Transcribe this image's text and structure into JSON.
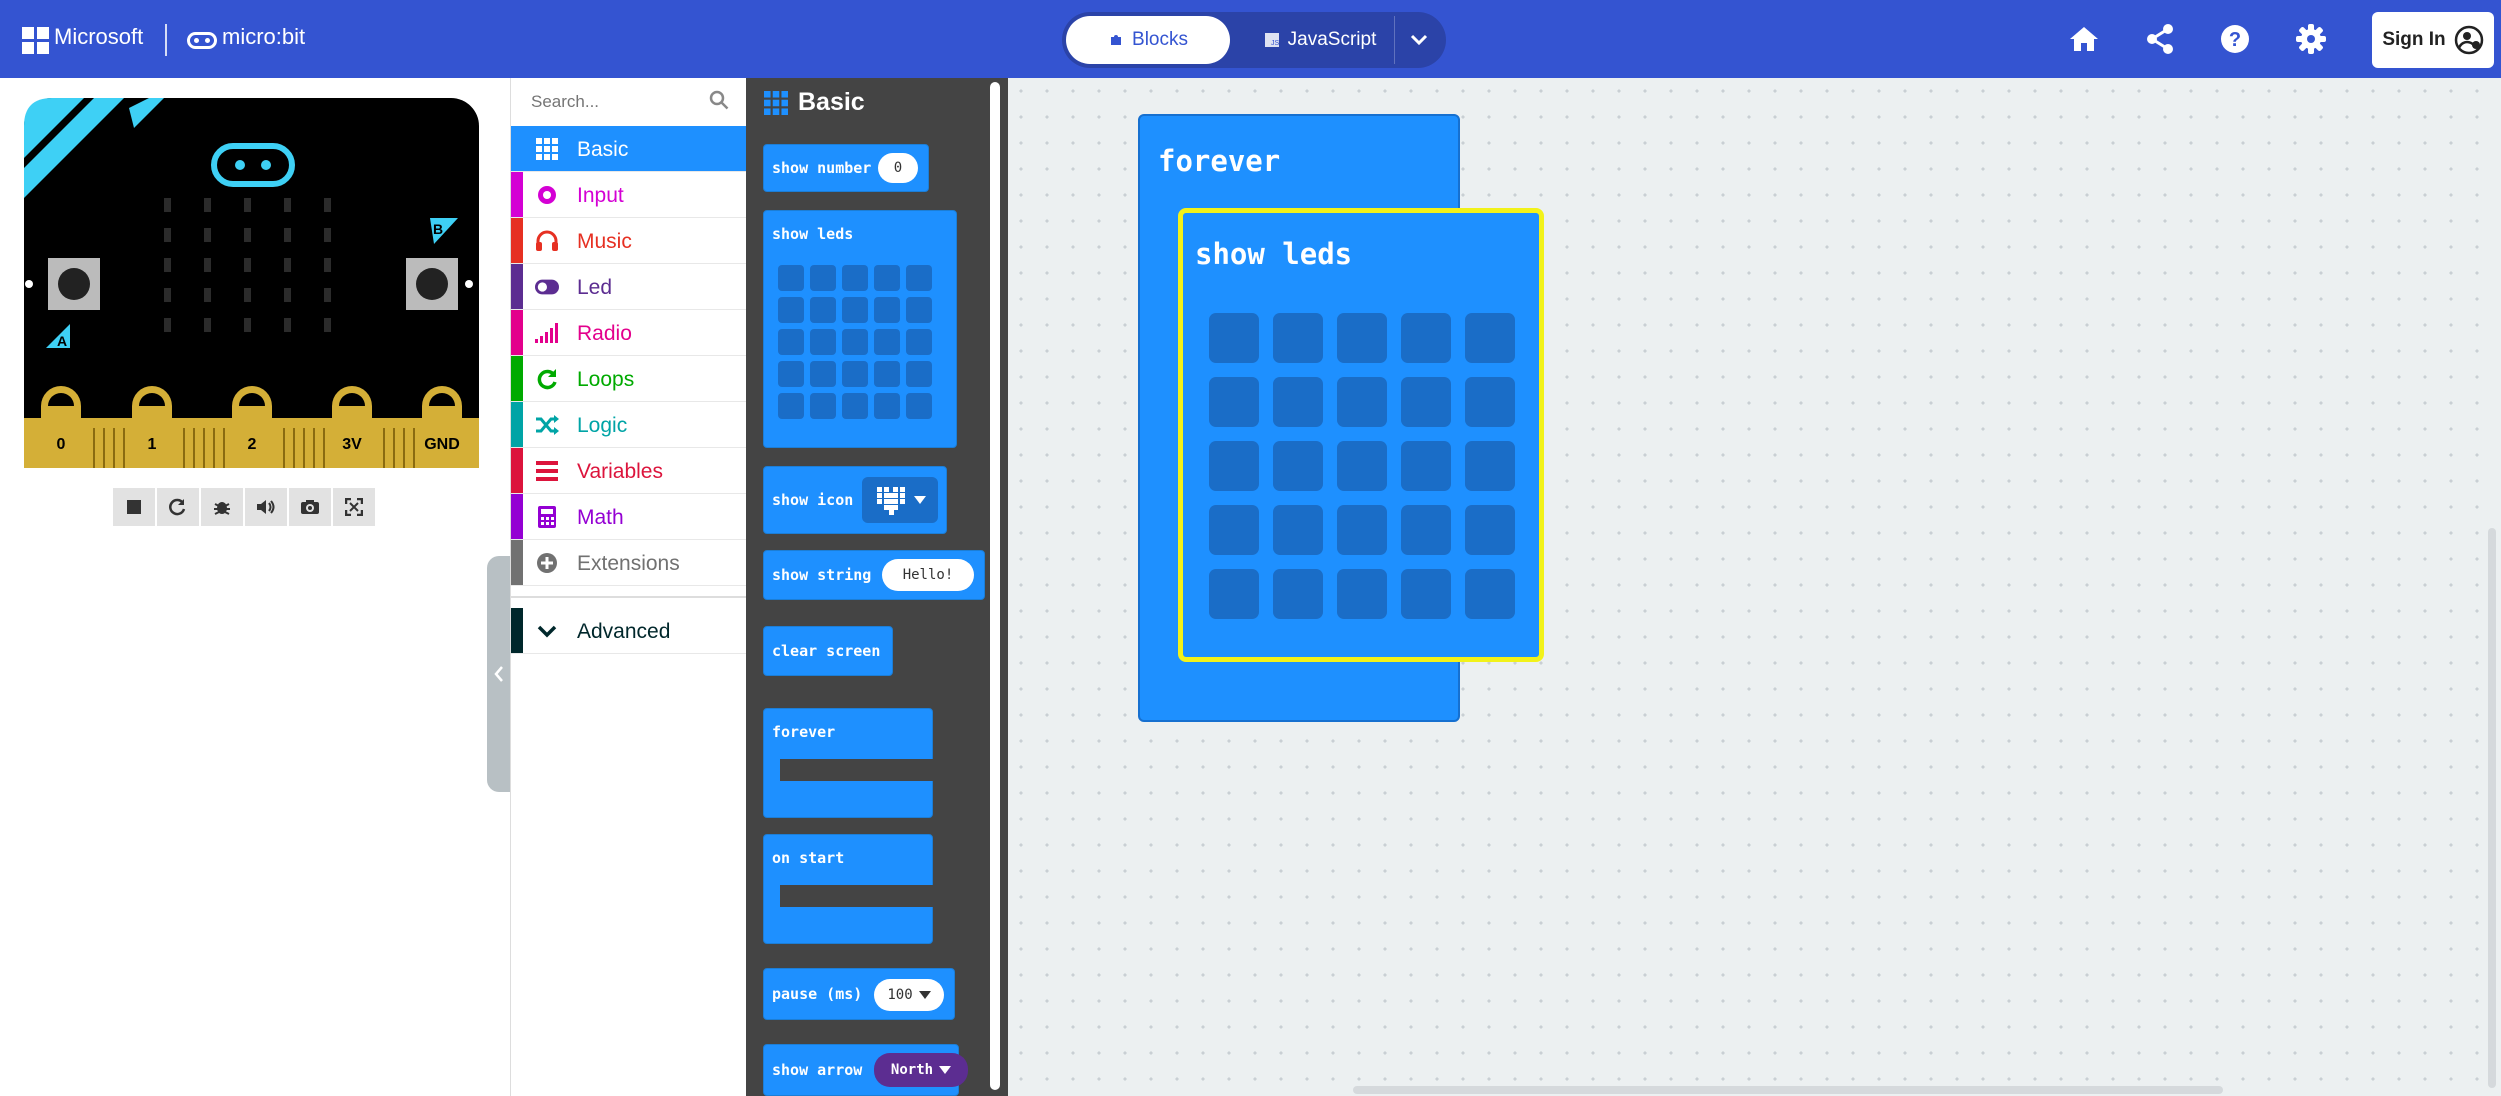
{
  "header": {
    "microsoft_label": "Microsoft",
    "microbit_label": "micro:bit",
    "tabs": [
      {
        "label": "Blocks",
        "active": true,
        "icon": "puzzle-icon"
      },
      {
        "label": "JavaScript",
        "active": false,
        "icon": "js-icon"
      }
    ],
    "icons": [
      "home-icon",
      "share-icon",
      "help-icon",
      "gear-icon"
    ],
    "signin_label": "Sign In"
  },
  "simulator": {
    "pin_labels": [
      "0",
      "1",
      "2",
      "3V",
      "GND"
    ],
    "button_labels": [
      "A",
      "B"
    ],
    "toolbar_icons": [
      "stop-icon",
      "restart-icon",
      "debug-icon",
      "sound-icon",
      "screenshot-icon",
      "fullscreen-icon"
    ]
  },
  "toolbox": {
    "search_placeholder": "Search...",
    "categories": [
      {
        "label": "Basic",
        "color": "#1e90ff",
        "selected": true,
        "icon": "grid-icon"
      },
      {
        "label": "Input",
        "color": "#d400d4",
        "icon": "circle-icon"
      },
      {
        "label": "Music",
        "color": "#e63022",
        "icon": "headphones-icon"
      },
      {
        "label": "Led",
        "color": "#5c2d91",
        "icon": "toggle-icon"
      },
      {
        "label": "Radio",
        "color": "#e3008c",
        "icon": "signal-icon"
      },
      {
        "label": "Loops",
        "color": "#00aa00",
        "icon": "refresh-icon"
      },
      {
        "label": "Logic",
        "color": "#00a4a6",
        "icon": "shuffle-icon"
      },
      {
        "label": "Variables",
        "color": "#dc143c",
        "icon": "list-icon"
      },
      {
        "label": "Math",
        "color": "#9400d3",
        "icon": "calculator-icon"
      },
      {
        "label": "Extensions",
        "color": "#717171",
        "icon": "plus-icon"
      },
      {
        "label": "Advanced",
        "color": "#00272b",
        "icon": "chevron-down-icon"
      }
    ]
  },
  "flyout": {
    "title": "Basic",
    "blocks": {
      "show_number": {
        "label": "show number",
        "value": "0"
      },
      "show_leds": {
        "label": "show leds"
      },
      "show_icon": {
        "label": "show icon"
      },
      "show_string": {
        "label": "show string",
        "value": "Hello!"
      },
      "clear_screen": {
        "label": "clear screen"
      },
      "forever": {
        "label": "forever"
      },
      "on_start": {
        "label": "on start"
      },
      "pause": {
        "label": "pause (ms)",
        "value": "100"
      },
      "show_arrow": {
        "label": "show arrow",
        "value": "North"
      }
    }
  },
  "workspace": {
    "forever_label": "forever",
    "show_leds_label": "show leds"
  }
}
